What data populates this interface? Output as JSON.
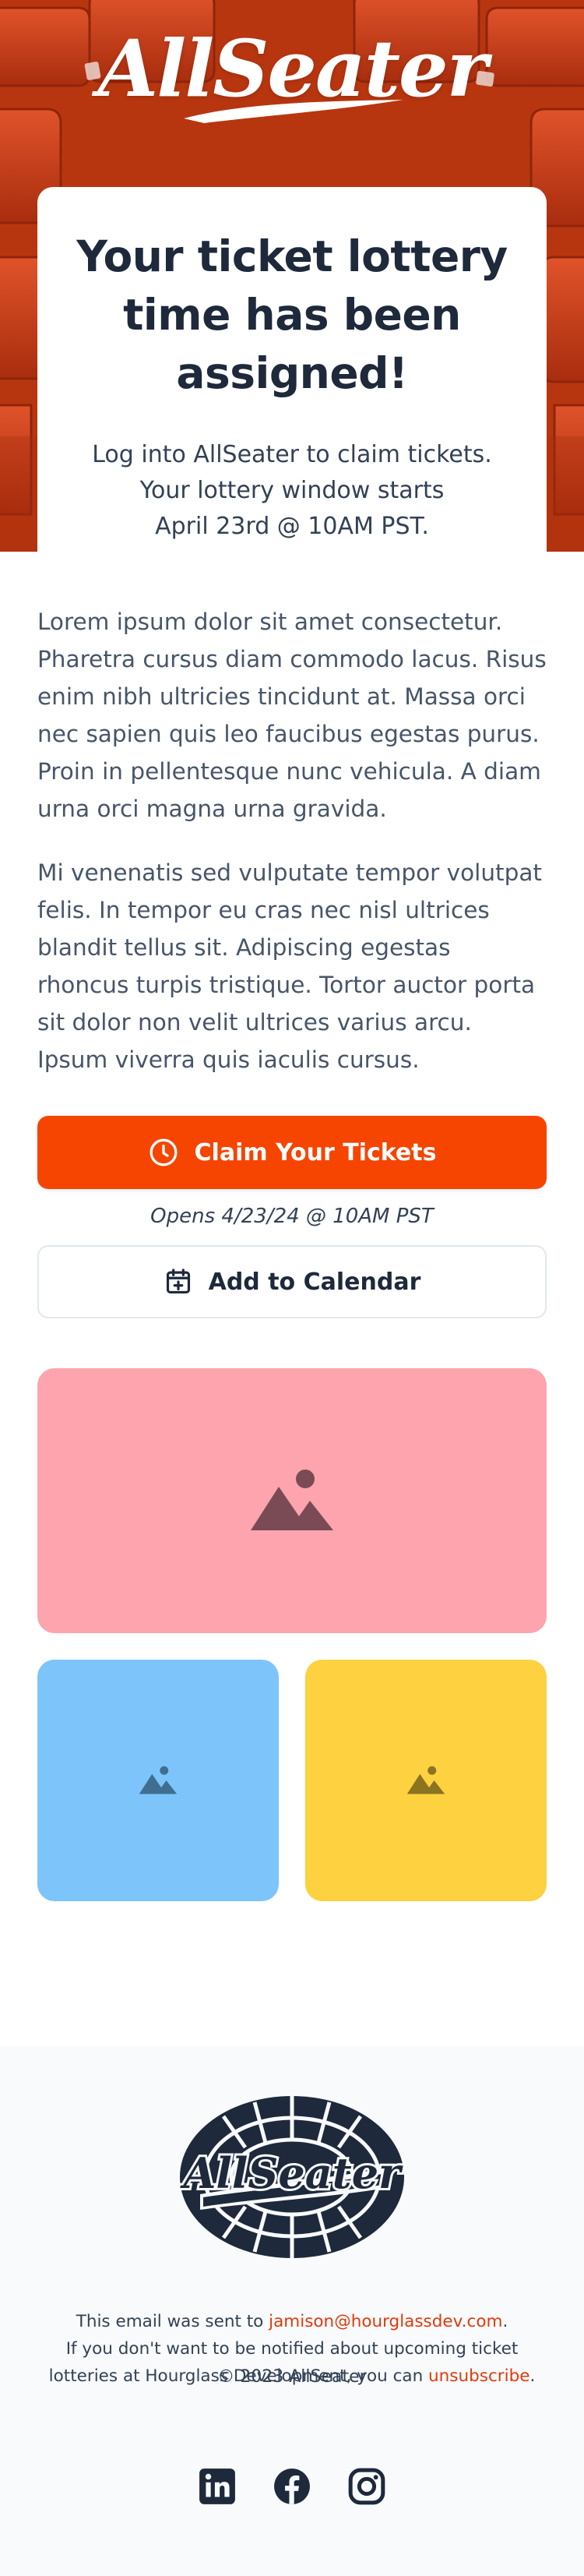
{
  "hero": {
    "logo_text": "AllSeater",
    "title": "Your ticket lottery time has been assigned!",
    "subtitle_lines": [
      "Log into AllSeater to claim tickets.",
      "Your lottery window starts",
      "April 23rd @ 10AM PST."
    ]
  },
  "body": {
    "paragraphs": [
      "Lorem ipsum dolor sit amet consectetur. Pharetra cursus diam commodo lacus. Risus enim nibh ultricies tincidunt at. Massa orci nec sapien quis leo faucibus egestas purus. Proin in pellentesque nunc vehicula. A diam urna orci magna urna gravida.",
      "Mi venenatis sed vulputate tempor volutpat felis. In tempor eu cras nec nisl ultrices blandit tellus sit. Adipiscing egestas rhoncus turpis tristique. Tortor auctor porta sit dolor non velit ultrices varius arcu. Ipsum viverra quis iaculis cursus."
    ],
    "claim_button_label": "Claim Your Tickets",
    "opens_text": "Opens 4/23/24 @ 10AM PST",
    "calendar_button_label": "Add to Calendar"
  },
  "images": {
    "large_color": "#fda4af",
    "small_left_color": "#7dc4fb",
    "small_right_color": "#fdd13f",
    "icon": "image-placeholder-icon"
  },
  "footer": {
    "logo_text": "AllSeater",
    "sent_prefix": "This email was sent to ",
    "email": "jamison@hourglassdev.com",
    "sent_suffix": ".",
    "line2": "If you don't want to be notified about upcoming ticket",
    "line3_prefix": "lotteries at Hourglass Development, you can ",
    "unsubscribe": "unsubscribe",
    "line3_suffix": ".",
    "copyright": "© 2023 AllSeater",
    "social": [
      "linkedin-icon",
      "facebook-icon",
      "instagram-icon"
    ]
  },
  "colors": {
    "brand": "#f54500",
    "hero_bg": "#c63a15",
    "text_dark": "#1e293b",
    "link": "#e03a0b"
  }
}
